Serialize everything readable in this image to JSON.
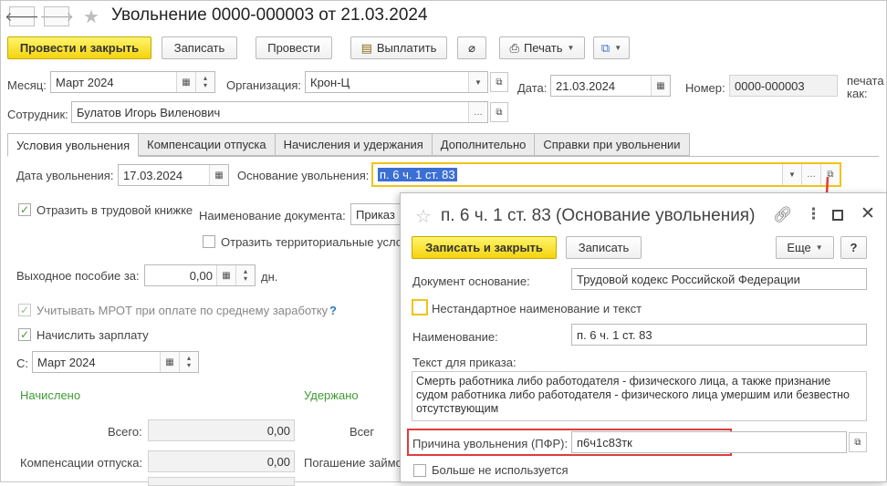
{
  "window": {
    "title": "Увольнение 0000-000003 от 21.03.2024"
  },
  "toolbar": {
    "post_close": "Провести и закрыть",
    "save": "Записать",
    "post": "Провести",
    "pay": "Выплатить",
    "print": "Печать"
  },
  "header": {
    "month_label": "Месяц:",
    "month_value": "Март 2024",
    "org_label": "Организация:",
    "org_value": "Крон-Ц",
    "date_label": "Дата:",
    "date_value": "21.03.2024",
    "number_label": "Номер:",
    "number_value": "0000-000003",
    "print_as_line1": "печата",
    "print_as_line2": "как:",
    "employee_label": "Сотрудник:",
    "employee_value": "Булатов Игорь Виленович"
  },
  "tabs": [
    {
      "label": "Условия увольнения"
    },
    {
      "label": "Компенсации отпуска"
    },
    {
      "label": "Начисления и удержания"
    },
    {
      "label": "Дополнительно"
    },
    {
      "label": "Справки при увольнении"
    }
  ],
  "main": {
    "dismissal_date_label": "Дата увольнения:",
    "dismissal_date_value": "17.03.2024",
    "basis_label": "Основание увольнения:",
    "basis_value": "п. 6 ч. 1 ст. 83",
    "workbook_label": "Отразить в трудовой книжке",
    "docname_label": "Наименование документа:",
    "docname_value": "Приказ",
    "territorial_label": "Отразить территориальные услов",
    "severance_label": "Выходное пособие за:",
    "severance_value": "0,00",
    "severance_unit": "дн.",
    "mrot_label": "Учитывать МРОТ при оплате по среднему заработку",
    "mrot_help": "?",
    "accrue_label": "Начислить зарплату",
    "from_label": "С:",
    "from_value": "Март 2024",
    "accrued_title": "Начислено",
    "withheld_title": "Удержано",
    "total_label": "Всего:",
    "total_value": "0,00",
    "withheld_total_label": "Всег",
    "comp_label": "Компенсации отпуска:",
    "comp_value": "0,00",
    "loan_label": "Погашение займо"
  },
  "popup": {
    "title": "п. 6 ч. 1 ст. 83 (Основание увольнения)",
    "save_close": "Записать и закрыть",
    "save": "Записать",
    "more": "Еще",
    "help": "?",
    "basis_doc_label": "Документ основание:",
    "basis_doc_value": "Трудовой кодекс Российской Федерации",
    "nonstandard_label": "Нестандартное наименование и текст",
    "name_label": "Наименование:",
    "name_value": "п. 6 ч. 1 ст. 83",
    "order_text_label": "Текст для приказа:",
    "order_text_value": "Смерть работника либо работодателя - физического лица, а также признание судом работника либо работодателя - физического лица умершим или безвестно отсутствующим",
    "pfr_label": "Причина увольнения (ПФР):",
    "pfr_value": "п6ч1с83тк",
    "not_used_label": "Больше не используется"
  },
  "colors": {
    "accent_yellow": "#f4d40e",
    "highlight_red": "#e03c3c",
    "selection_blue": "#3b6fd4",
    "check_green": "#4a9a32"
  }
}
